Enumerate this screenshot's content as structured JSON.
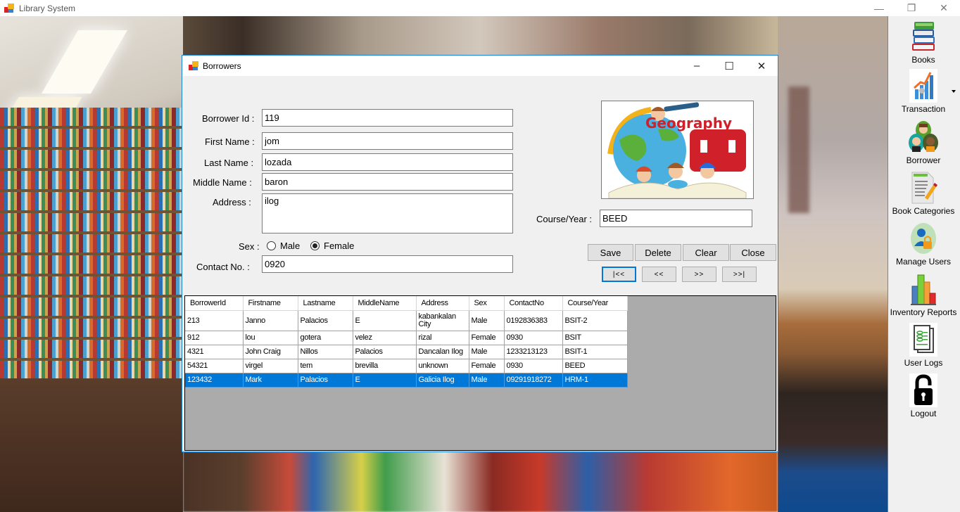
{
  "app": {
    "title": "Library System",
    "controls": {
      "minimize": "—",
      "restore": "❐",
      "close": "✕"
    }
  },
  "sidebar": {
    "items": [
      {
        "label": "Books",
        "icon": "books-stack-icon"
      },
      {
        "label": "Transaction",
        "icon": "transaction-chart-icon",
        "has_dropdown": true
      },
      {
        "label": "Borrower",
        "icon": "borrower-people-icon"
      },
      {
        "label": "Book Categories",
        "icon": "document-edit-icon"
      },
      {
        "label": "Manage Users",
        "icon": "user-lock-icon"
      },
      {
        "label": "Inventory Reports",
        "icon": "bar-chart-icon"
      },
      {
        "label": "User Logs",
        "icon": "log-document-icon"
      },
      {
        "label": "Logout",
        "icon": "padlock-icon"
      }
    ]
  },
  "dialog": {
    "title": "Borrowers",
    "controls": {
      "minimize": "–",
      "maximize": "☐",
      "close": "✕"
    },
    "form": {
      "borrower_id": {
        "label": "Borrower Id :",
        "value": "119"
      },
      "first_name": {
        "label": "First Name :",
        "value": "jom"
      },
      "last_name": {
        "label": "Last Name :",
        "value": "lozada"
      },
      "middle_name": {
        "label": "Middle Name :",
        "value": "baron"
      },
      "address": {
        "label": "Address :",
        "value": "ilog"
      },
      "sex": {
        "label": "Sex :",
        "options": [
          "Male",
          "Female"
        ],
        "selected": "Female"
      },
      "contact_no": {
        "label": "Contact No. :",
        "value": "0920"
      },
      "course_year": {
        "label": "Course/Year :",
        "value": "BEED"
      },
      "picture": {
        "caption": "Geography"
      }
    },
    "buttons": {
      "save": "Save",
      "delete": "Delete",
      "clear": "Clear",
      "close": "Close",
      "first": "|<<",
      "prev": "<<",
      "next": ">>",
      "last": ">>|"
    },
    "grid": {
      "columns": [
        "BorrowerId",
        "Firstname",
        "Lastname",
        "MiddleName",
        "Address",
        "Sex",
        "ContactNo",
        "Course/Year"
      ],
      "rows": [
        [
          "213",
          "Janno",
          "Palacios",
          "E",
          "kabankalan City",
          "Male",
          "0192836383",
          "BSIT-2"
        ],
        [
          "912",
          "lou",
          "gotera",
          "velez",
          "rizal",
          "Female",
          "0930",
          "BSIT"
        ],
        [
          "4321",
          "John Craig",
          "Nillos",
          "Palacios",
          "Dancalan Ilog",
          "Male",
          "1233213123",
          "BSIT-1"
        ],
        [
          "54321",
          "virgel",
          "tem",
          "brevilla",
          "unknown",
          "Female",
          "0930",
          "BEED"
        ],
        [
          "123432",
          "Mark",
          "Palacios",
          "E",
          "Galicia Ilog",
          "Male",
          "09291918272",
          "HRM-1"
        ]
      ],
      "selected_row": 4
    }
  },
  "colors": {
    "accent": "#0078d7",
    "dialog_border": "#1883d7",
    "grid_background": "#ababab",
    "form_background": "#f0f0f0"
  }
}
